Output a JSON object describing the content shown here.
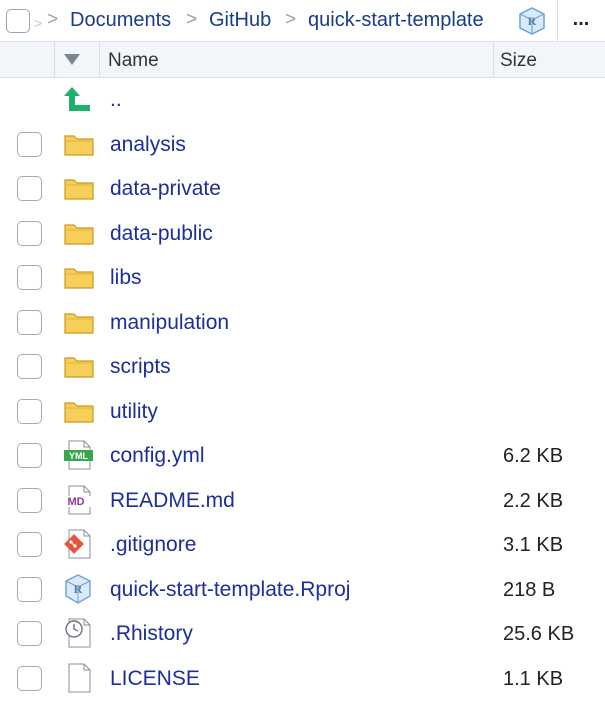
{
  "breadcrumb": {
    "items": [
      "Documents",
      "GitHub",
      "quick-start-template"
    ],
    "separator": ">",
    "more_label": "..."
  },
  "columns": {
    "name": "Name",
    "size": "Size"
  },
  "colors": {
    "link": "#1b2e9b",
    "folder_fill": "#f6cf5a",
    "folder_stroke": "#c99a1c",
    "yml_green": "#3aa64a",
    "md_purple": "#8c3a9e",
    "git_orange": "#e3563a",
    "rproj_blue": "#6fa3d6",
    "up_arrow_green": "#1bb36a"
  },
  "files": [
    {
      "name": "..",
      "icon": "up-arrow-icon",
      "size": "",
      "checkbox": false
    },
    {
      "name": "analysis",
      "icon": "folder-icon",
      "size": "",
      "checkbox": true
    },
    {
      "name": "data-private",
      "icon": "folder-icon",
      "size": "",
      "checkbox": true
    },
    {
      "name": "data-public",
      "icon": "folder-icon",
      "size": "",
      "checkbox": true
    },
    {
      "name": "libs",
      "icon": "folder-icon",
      "size": "",
      "checkbox": true
    },
    {
      "name": "manipulation",
      "icon": "folder-icon",
      "size": "",
      "checkbox": true
    },
    {
      "name": "scripts",
      "icon": "folder-icon",
      "size": "",
      "checkbox": true
    },
    {
      "name": "utility",
      "icon": "folder-icon",
      "size": "",
      "checkbox": true
    },
    {
      "name": "config.yml",
      "icon": "yml-file-icon",
      "size": "6.2 KB",
      "checkbox": true
    },
    {
      "name": "README.md",
      "icon": "markdown-file-icon",
      "size": "2.2 KB",
      "checkbox": true
    },
    {
      "name": ".gitignore",
      "icon": "git-file-icon",
      "size": "3.1 KB",
      "checkbox": true
    },
    {
      "name": "quick-start-template.Rproj",
      "icon": "rproj-file-icon",
      "size": "218 B",
      "checkbox": true
    },
    {
      "name": ".Rhistory",
      "icon": "history-file-icon",
      "size": "25.6 KB",
      "checkbox": true
    },
    {
      "name": "LICENSE",
      "icon": "blank-file-icon",
      "size": "1.1 KB",
      "checkbox": true
    }
  ]
}
